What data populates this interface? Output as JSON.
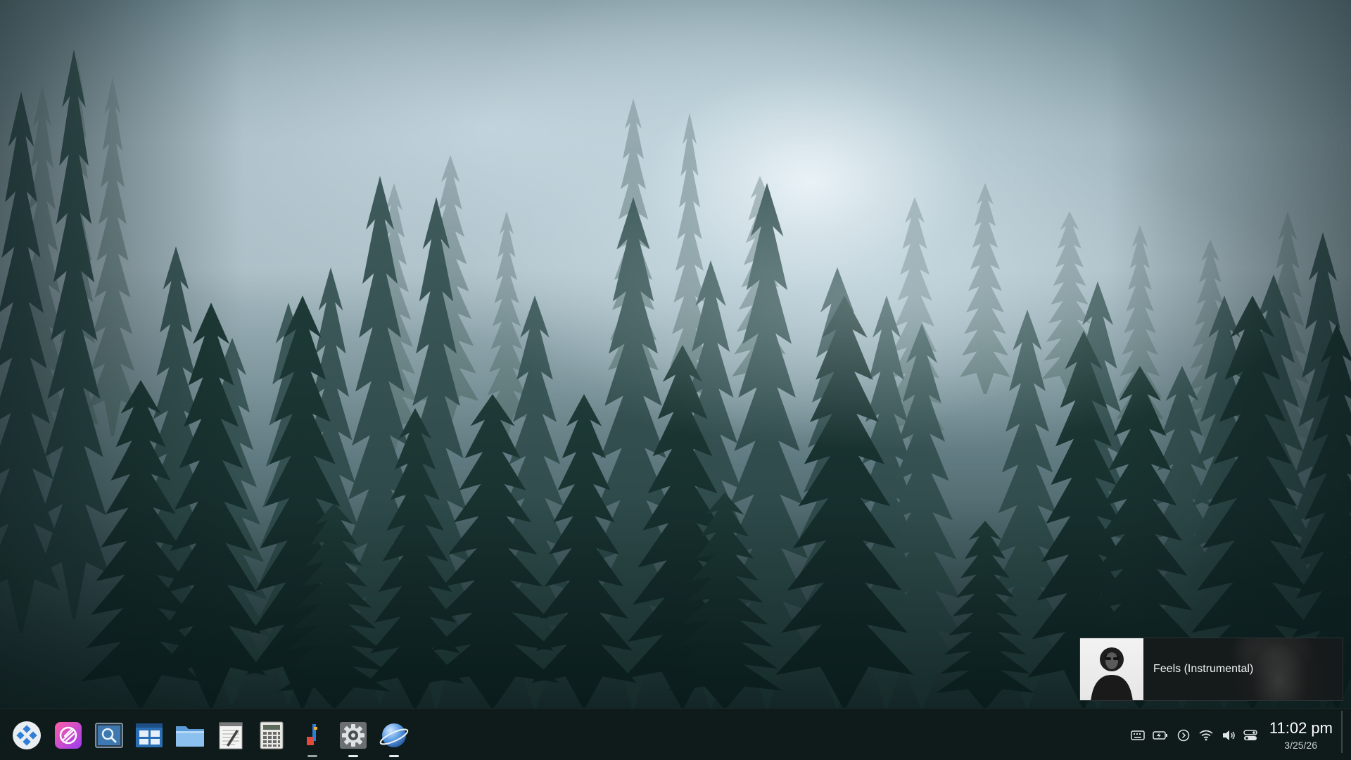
{
  "media": {
    "track_title": "Feels (Instrumental)"
  },
  "taskbar": {
    "launchers": [
      {
        "name": "app-launcher-icon",
        "running": false
      },
      {
        "name": "creative-app-icon",
        "running": false
      },
      {
        "name": "search-app-icon",
        "running": false
      },
      {
        "name": "system-monitor-icon",
        "running": false
      },
      {
        "name": "file-manager-icon",
        "running": false
      },
      {
        "name": "text-editor-icon",
        "running": false
      },
      {
        "name": "calculator-icon",
        "running": false
      },
      {
        "name": "music-player-icon",
        "running": true
      },
      {
        "name": "system-settings-icon",
        "running": true,
        "active": true
      },
      {
        "name": "web-browser-icon",
        "running": true,
        "active": true
      }
    ],
    "tray": [
      "keyboard-layout-icon",
      "battery-icon",
      "media-play-icon",
      "wifi-icon",
      "volume-icon",
      "toggles-icon"
    ]
  },
  "clock": {
    "time": "11:02 pm",
    "date": "3/25/26"
  },
  "colors": {
    "taskbar_bg": "#0f1a1a",
    "accent_pink": "#e0489a",
    "accent_blue": "#2f7fd6"
  }
}
